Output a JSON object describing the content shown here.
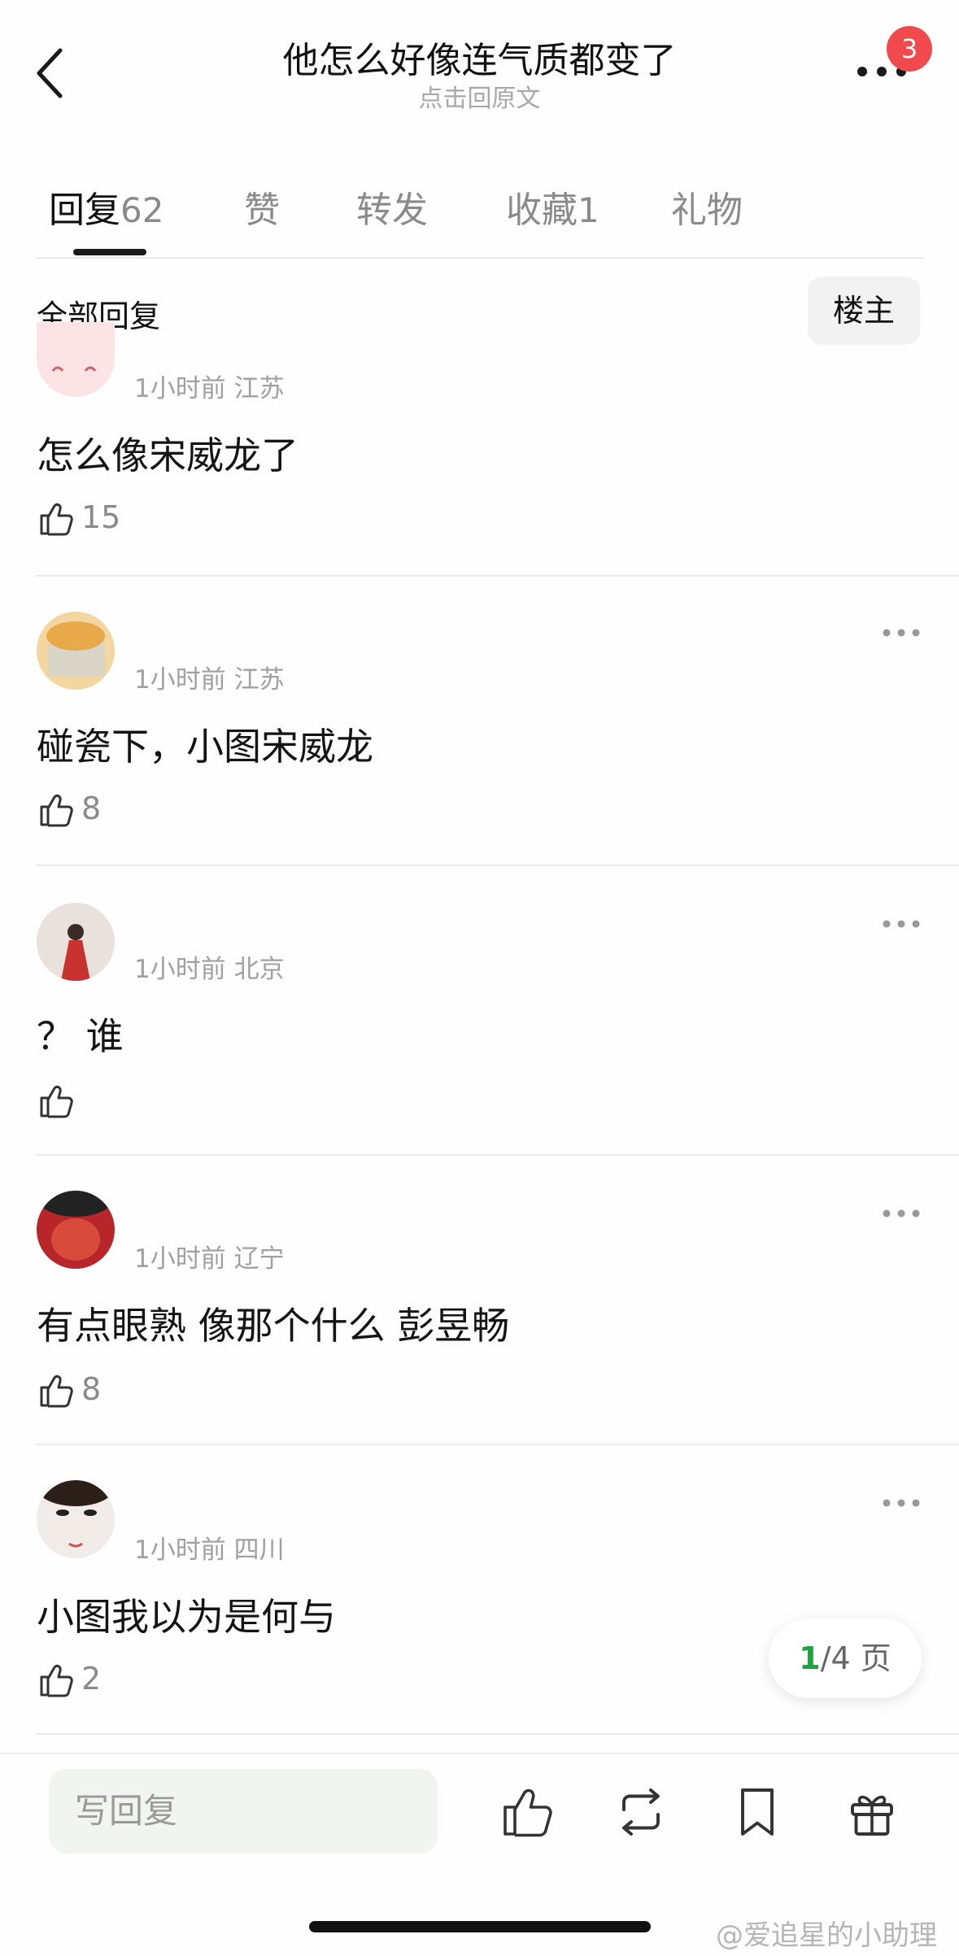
{
  "header": {
    "title": "他怎么好像连气质都变了",
    "subtitle": "点击回原文",
    "notification_count": "3"
  },
  "tabs": [
    {
      "label": "回复",
      "count": "62"
    },
    {
      "label": "赞",
      "count": ""
    },
    {
      "label": "转发",
      "count": ""
    },
    {
      "label": "收藏",
      "count": "1"
    },
    {
      "label": "礼物",
      "count": ""
    }
  ],
  "filter": {
    "all_label": "全部回复",
    "op_label": "楼主"
  },
  "comments": [
    {
      "username": "",
      "meta": "1小时前 江苏",
      "content": "怎么像宋威龙了",
      "likes": "15"
    },
    {
      "username": "",
      "meta": "1小时前 江苏",
      "content": "碰瓷下，小图宋威龙",
      "likes": "8"
    },
    {
      "username": "",
      "meta": "1小时前 北京",
      "content": "？ 谁",
      "likes": ""
    },
    {
      "username": "",
      "meta": "1小时前 辽宁",
      "content": "有点眼熟 像那个什么 彭昱畅",
      "likes": "8"
    },
    {
      "username": "",
      "meta": "1小时前 四川",
      "content": "小图我以为是何与",
      "likes": "2"
    }
  ],
  "pager": {
    "current": "1",
    "total": "/4 页"
  },
  "bottom": {
    "reply_placeholder": "写回复"
  },
  "watermark": "@爱追星的小助理",
  "colors": {
    "badge": "#f04a4c",
    "pager_current": "#1aa83e"
  },
  "icons": [
    "back-arrow-icon",
    "more-dots-icon",
    "thumb-up-icon",
    "repost-icon",
    "bookmark-icon",
    "gift-icon"
  ]
}
